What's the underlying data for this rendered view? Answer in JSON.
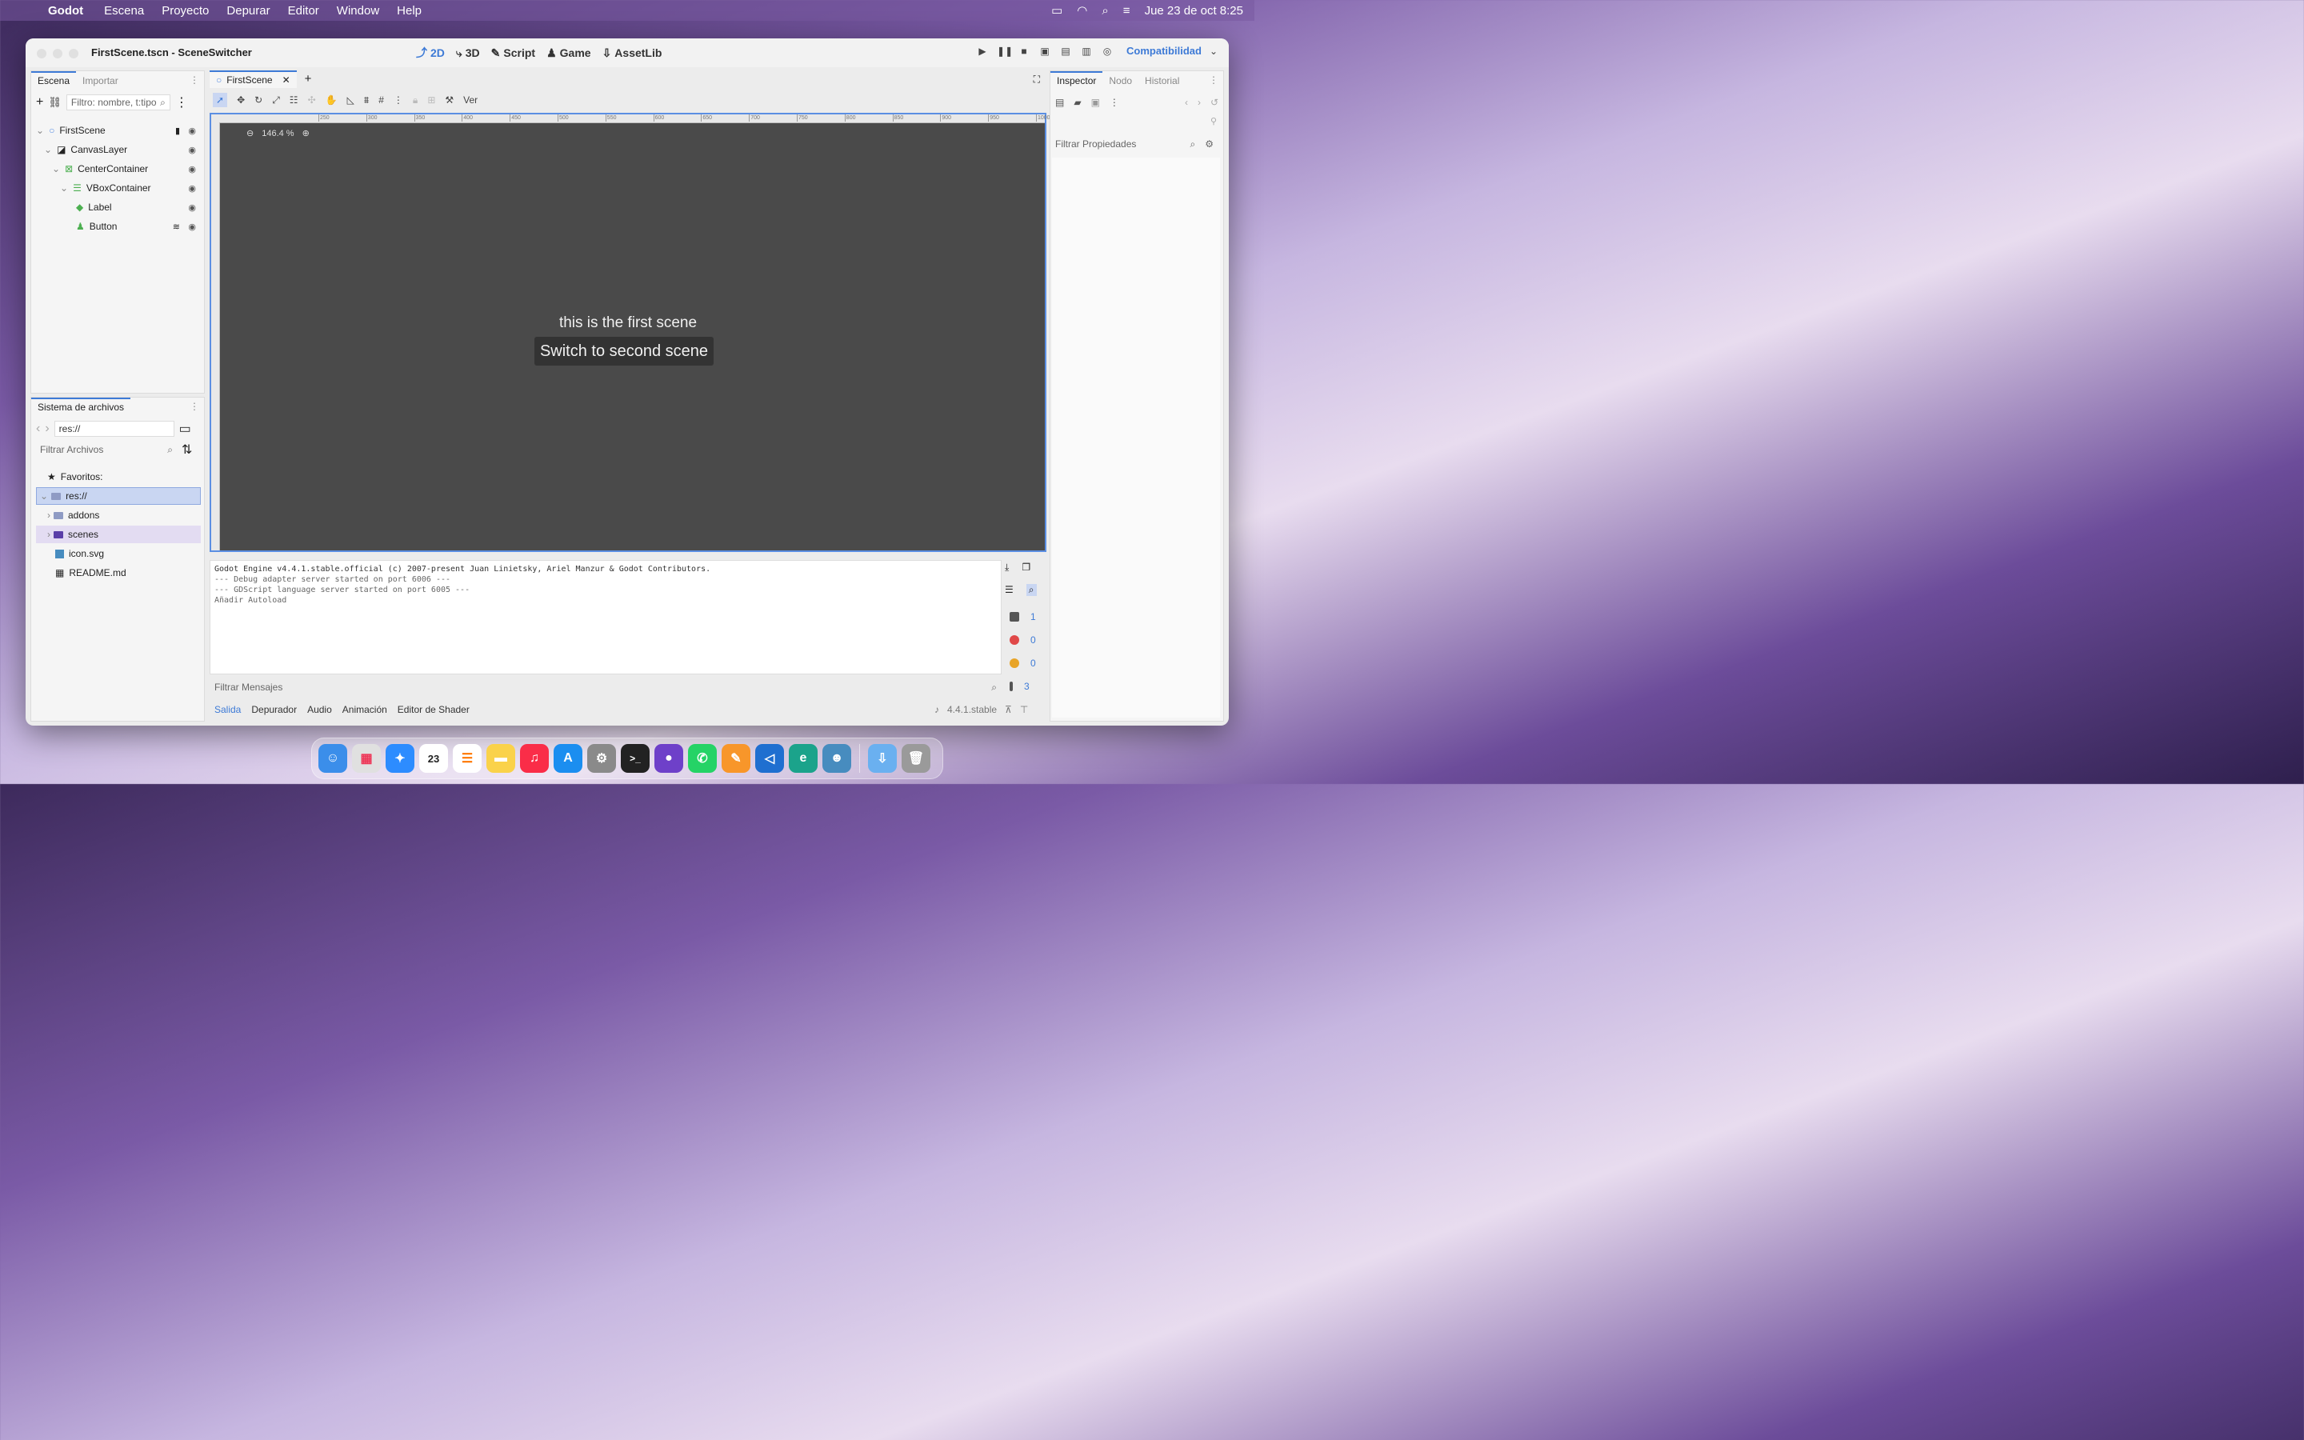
{
  "menubar": {
    "app_name": "Godot",
    "items": [
      "Escena",
      "Proyecto",
      "Depurar",
      "Editor",
      "Window",
      "Help"
    ],
    "clock": "Jue 23 de oct  8:25"
  },
  "window": {
    "title": "FirstScene.tscn - SceneSwitcher",
    "modes": [
      {
        "label": "2D",
        "icon": "2d-icon",
        "active": true
      },
      {
        "label": "3D",
        "icon": "3d-icon"
      },
      {
        "label": "Script",
        "icon": "script-icon"
      },
      {
        "label": "Game",
        "icon": "game-icon"
      },
      {
        "label": "AssetLib",
        "icon": "assetlib-icon"
      }
    ],
    "renderer": "Compatibilidad"
  },
  "scene_panel": {
    "tabs": [
      "Escena",
      "Importar"
    ],
    "filter_placeholder": "Filtro: nombre, t:tipo",
    "tree": [
      {
        "name": "FirstScene",
        "icon": "node2d-circle-icon"
      },
      {
        "name": "CanvasLayer",
        "icon": "canvaslayer-icon"
      },
      {
        "name": "CenterContainer",
        "icon": "centercontainer-icon"
      },
      {
        "name": "VBoxContainer",
        "icon": "vboxcontainer-icon"
      },
      {
        "name": "Label",
        "icon": "label-icon"
      },
      {
        "name": "Button",
        "icon": "button-icon"
      }
    ]
  },
  "filesystem": {
    "title": "Sistema de archivos",
    "path": "res://",
    "filter_placeholder": "Filtrar Archivos",
    "favorites": "Favoritos:",
    "items": [
      "res://",
      "addons",
      "scenes",
      "icon.svg",
      "README.md"
    ]
  },
  "editor": {
    "tab": "FirstScene",
    "zoom": "146.4 %",
    "view_menu": "Ver",
    "scene_label": "this is the first scene",
    "scene_button": "Switch to second scene",
    "ruler_ticks": [
      "250",
      "300",
      "350",
      "400",
      "450",
      "500",
      "550",
      "600",
      "650",
      "700",
      "750",
      "800",
      "850",
      "900",
      "950",
      "1000"
    ]
  },
  "console": {
    "lines": [
      "Godot Engine v4.4.1.stable.official (c) 2007-present Juan Linietsky, Ariel Manzur & Godot Contributors.",
      "--- Debug adapter server started on port 6006 ---",
      "--- GDScript language server started on port 6005 ---",
      "Añadir Autoload"
    ],
    "filter_placeholder": "Filtrar Mensajes",
    "counts": {
      "messages": "1",
      "errors": "0",
      "warnings": "0",
      "info": "3"
    },
    "tabs": [
      "Salida",
      "Depurador",
      "Audio",
      "Animación",
      "Editor de Shader"
    ],
    "version": "4.4.1.stable"
  },
  "inspector": {
    "tabs": [
      "Inspector",
      "Nodo",
      "Historial"
    ],
    "filter_placeholder": "Filtrar Propiedades"
  },
  "colors": {
    "accent": "#3d7ad6",
    "viewport": "#4a4a4a"
  }
}
